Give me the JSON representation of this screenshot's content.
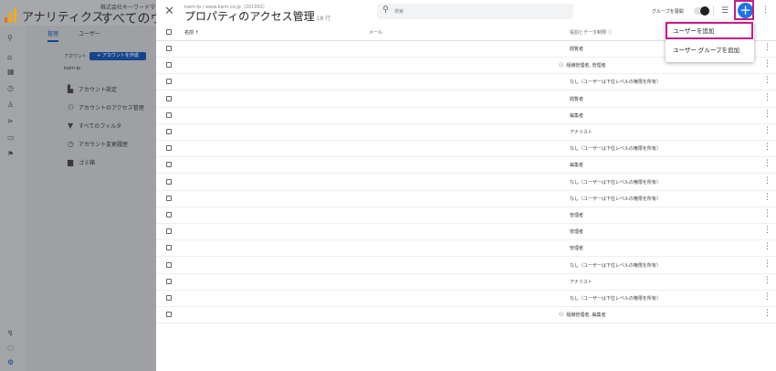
{
  "colors": {
    "accent": "#1a73e8",
    "highlight": "#c51d88",
    "logo_orange": "#f9ab00",
    "logo_dark": "#e37400"
  },
  "background": {
    "app_name": "アナリティクス",
    "account_small": "株式会社キーワードマー",
    "account_view": "すべてのウェ",
    "tabs": [
      "管理",
      "ユーザー"
    ],
    "account_label": "アカウント",
    "create_account": "+ アカウントを作成",
    "account_name": "kwm-lp",
    "nav": [
      {
        "icon": "building-icon",
        "label": "アカウント設定"
      },
      {
        "icon": "people-icon",
        "label": "アカウントのアクセス管理"
      },
      {
        "icon": "filter-icon",
        "label": "すべてのフィルタ"
      },
      {
        "icon": "history-icon",
        "label": "アカウント変更履歴"
      },
      {
        "icon": "trash-icon",
        "label": "ゴミ箱"
      }
    ]
  },
  "panel": {
    "breadcrumb": "kwm-lp / www.kwm.co.jp（201002）",
    "title": "プロパティのアクセス管理",
    "count": "18 行",
    "search_placeholder": "検索",
    "group_toggle_label": "グループを展開",
    "columns": {
      "name": "名前 ↑",
      "email": "メール",
      "role": "役割とデータ制限 ⓘ"
    },
    "rows": [
      {
        "role": "閲覧者",
        "group": false
      },
      {
        "role": "組織管理者, 管理者",
        "group": true
      },
      {
        "role": "なし（ユーザーは下位レベルの権限を所有）",
        "group": false
      },
      {
        "role": "閲覧者",
        "group": false
      },
      {
        "role": "編集者",
        "group": false
      },
      {
        "role": "アナリスト",
        "group": false
      },
      {
        "role": "なし（ユーザーは下位レベルの権限を所有）",
        "group": false
      },
      {
        "role": "編集者",
        "group": false
      },
      {
        "role": "なし（ユーザーは下位レベルの権限を所有）",
        "group": false
      },
      {
        "role": "なし（ユーザーは下位レベルの権限を所有）",
        "group": false
      },
      {
        "role": "管理者",
        "group": false
      },
      {
        "role": "管理者",
        "group": false
      },
      {
        "role": "管理者",
        "group": false
      },
      {
        "role": "なし（ユーザーは下位レベルの権限を所有）",
        "group": false
      },
      {
        "role": "アナリスト",
        "group": false
      },
      {
        "role": "なし（ユーザーは下位レベルの権限を所有）",
        "group": false
      },
      {
        "role": "組織管理者, 編集者",
        "group": true
      }
    ]
  },
  "menu": {
    "items": [
      "ユーザーを追加",
      "ユーザー グループを追加"
    ]
  }
}
